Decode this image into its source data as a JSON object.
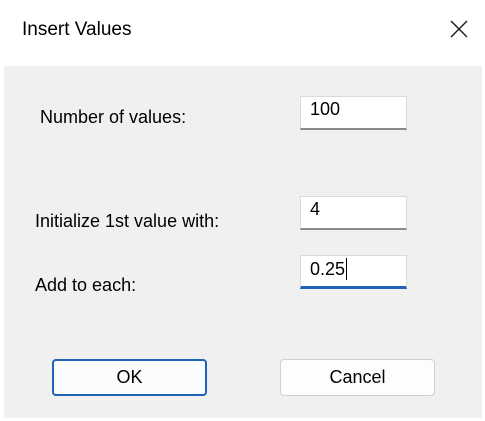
{
  "window": {
    "title": "Insert Values",
    "close_icon": "close-icon"
  },
  "form": {
    "number_of_values": {
      "label": "Number of values:",
      "value": "100"
    },
    "initial_value": {
      "label": "Initialize 1st value with:",
      "value": "4"
    },
    "increment": {
      "label": "Add to each:",
      "value": "0.25",
      "focused": true
    }
  },
  "buttons": {
    "ok_label": "OK",
    "cancel_label": "Cancel"
  },
  "colors": {
    "focus_accent": "#1f63b7",
    "client_background": "#f0f0f0"
  }
}
